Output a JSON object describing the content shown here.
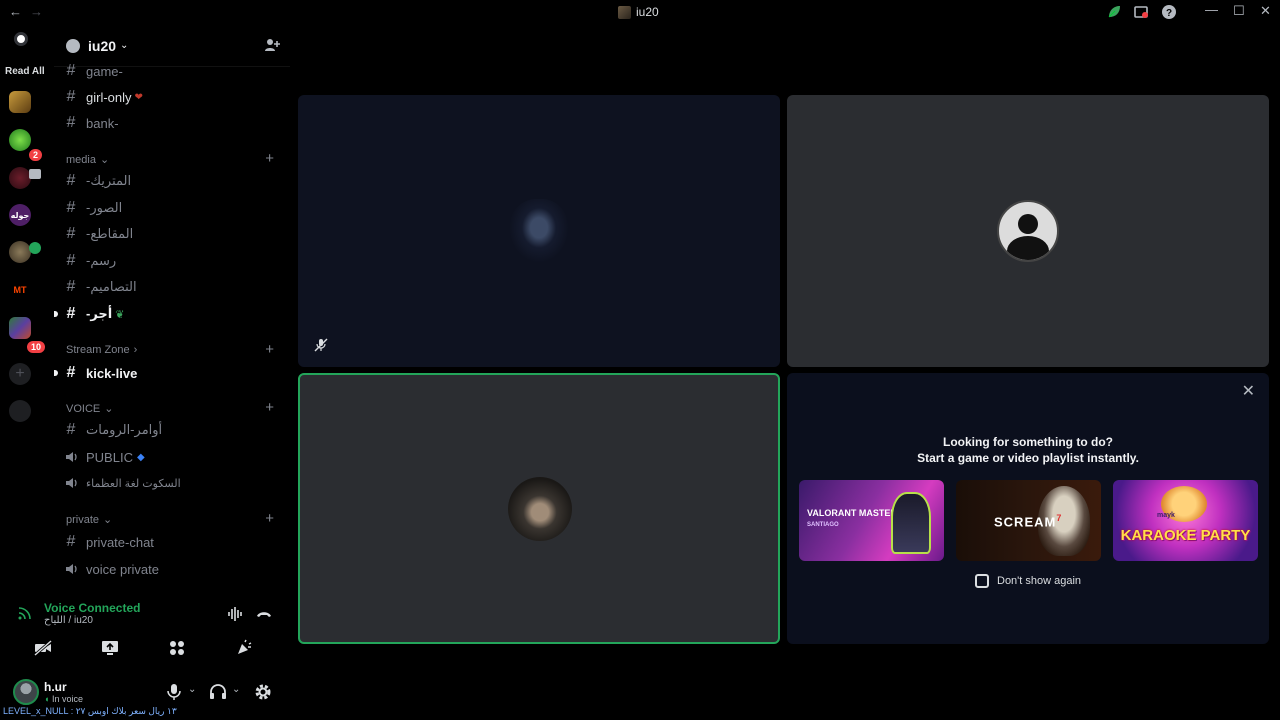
{
  "window": {
    "title": "iu20",
    "back": "←",
    "forward": "→",
    "minimize": "—",
    "maximize": "☐",
    "close": "✕",
    "help": "?"
  },
  "rail": {
    "read_all": "Read All",
    "badges": [
      "2",
      "10"
    ],
    "server_text": "جوله",
    "mt_text": "MT"
  },
  "server": {
    "name": "iu20",
    "chevron": "⌄"
  },
  "channels": [
    {
      "name": "game-",
      "type": "text"
    },
    {
      "name": "girl-only",
      "type": "text"
    },
    {
      "name": "bank-",
      "type": "text"
    },
    {
      "name": "-المتريك",
      "type": "text"
    },
    {
      "name": "-الصور",
      "type": "text"
    },
    {
      "name": "-المقاطع",
      "type": "text"
    },
    {
      "name": "-رسم",
      "type": "text"
    },
    {
      "name": "-التصاميم",
      "type": "text"
    },
    {
      "name": "-أجر",
      "type": "text"
    },
    {
      "name": "kick-live",
      "type": "text"
    },
    {
      "name": "أوامر-الرومات",
      "type": "text"
    },
    {
      "name": "PUBLIC",
      "type": "voice"
    },
    {
      "name": "السكوت لغة العظماء",
      "type": "voice"
    },
    {
      "name": "private-chat",
      "type": "text"
    },
    {
      "name": "voice private",
      "type": "voice"
    }
  ],
  "categories": {
    "media": "media",
    "stream": "Stream Zone",
    "voice": "VOICE",
    "private": "private"
  },
  "symbols": {
    "hash": "#",
    "plus": "+",
    "chev_down": "⌄",
    "chev_right": "›"
  },
  "voice_panel": {
    "status": "Voice Connected",
    "location": "اللياح / iu20"
  },
  "user": {
    "name": "h.ur",
    "status": "In voice"
  },
  "footer": "LEVEL_x_NULL : ١٣ ريال سعر بلاك اوبس ٢٧",
  "activity": {
    "close": "✕",
    "title": "Looking for something to do?",
    "subtitle": "Start a game or video playlist instantly.",
    "cards": [
      {
        "name": "VALORANT MASTERS",
        "sub": "SANTIAGO"
      },
      {
        "name": "SCREAM",
        "sub": "7"
      },
      {
        "name": "KARAOKE PARTY",
        "sub": "mayk"
      }
    ],
    "dont_show": "Don't show again"
  },
  "colors": {
    "voice_connected": "#23a55a",
    "speaking_border": "#23a55a",
    "badge": "#f23f43",
    "tile_bg": "#2b2d31"
  }
}
